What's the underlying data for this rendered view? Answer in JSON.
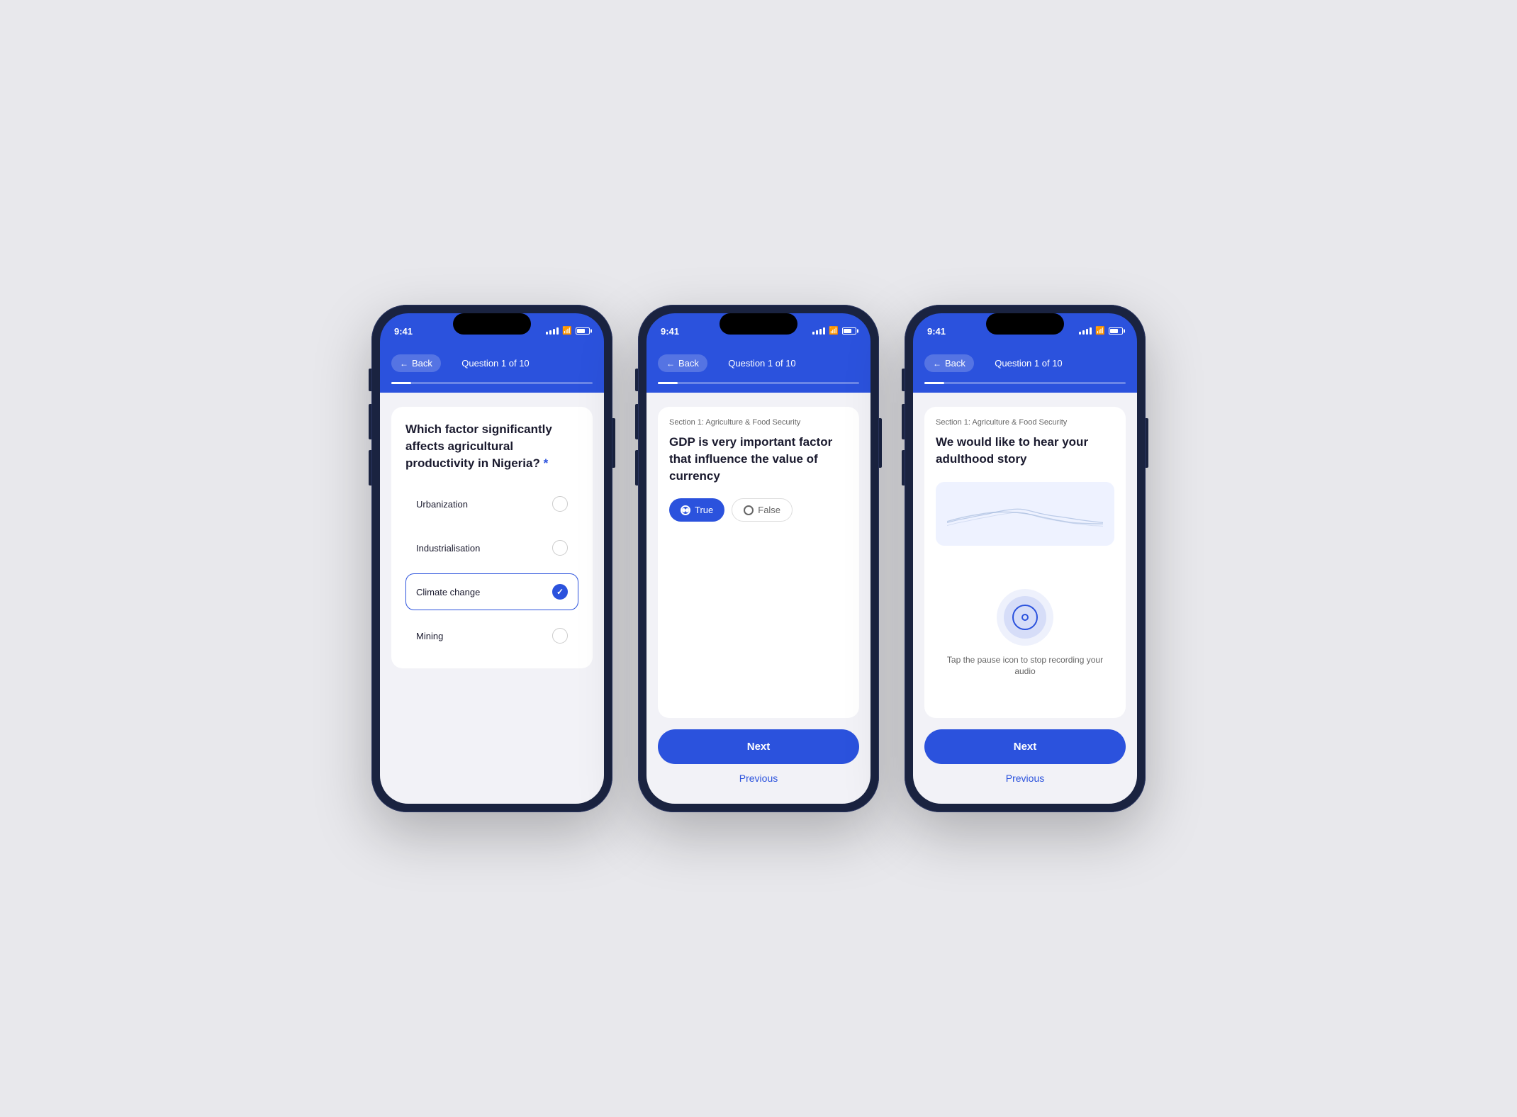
{
  "colors": {
    "primary": "#2b52dd",
    "background": "#e8e8ec",
    "white": "#ffffff",
    "dark": "#1a1a2e",
    "gray": "#666666"
  },
  "phones": [
    {
      "id": "phone1",
      "statusTime": "9:41",
      "navBack": "Back",
      "navTitle": "Question 1 of 10",
      "type": "multiple-choice",
      "questionTitle": "Which factor significantly affects agricultural productivity in Nigeria?",
      "required": true,
      "options": [
        {
          "label": "Urbanization",
          "selected": false
        },
        {
          "label": "Industrialisation",
          "selected": false
        },
        {
          "label": "Climate change",
          "selected": true
        },
        {
          "label": "Mining",
          "selected": false
        }
      ]
    },
    {
      "id": "phone2",
      "statusTime": "9:41",
      "navBack": "Back",
      "navTitle": "Question 1 of 10",
      "type": "true-false",
      "sectionLabel": "Section 1: Agriculture & Food Security",
      "questionTitle": "GDP is very important factor that influence the value of currency",
      "trueLabel": "True",
      "falseLabel": "False",
      "selectedAnswer": "true",
      "nextLabel": "Next",
      "previousLabel": "Previous"
    },
    {
      "id": "phone3",
      "statusTime": "9:41",
      "navBack": "Back",
      "navTitle": "Question 1 of 10",
      "type": "audio-record",
      "sectionLabel": "Section 1: Agriculture & Food Security",
      "questionTitle": "We would like to hear your adulthood story",
      "recordHint": "Tap the pause icon to stop recording your audio",
      "nextLabel": "Next",
      "previousLabel": "Previous"
    }
  ]
}
